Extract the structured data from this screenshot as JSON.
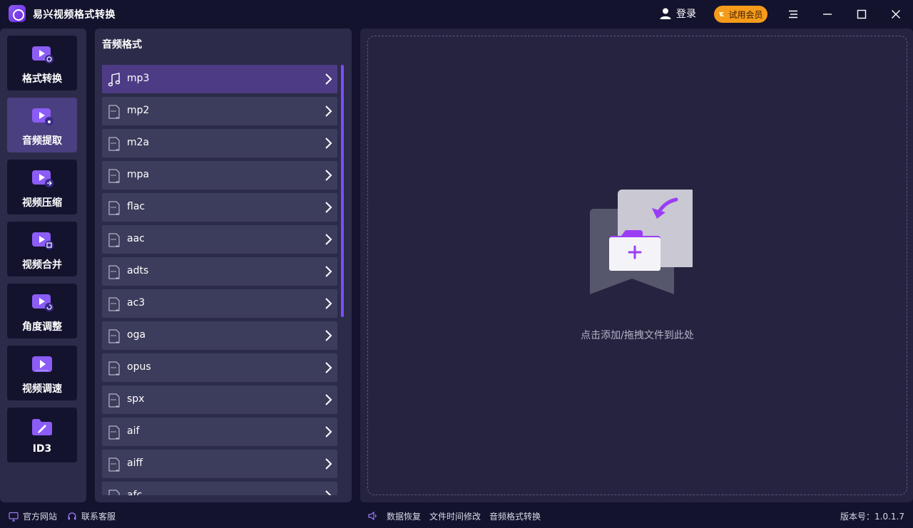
{
  "app": {
    "title": "易兴视频格式转换"
  },
  "header": {
    "login_label": "登录",
    "vip_label": "试用会员"
  },
  "nav": {
    "items": [
      {
        "label": "格式转换",
        "icon": "video-convert-icon",
        "active": false
      },
      {
        "label": "音频提取",
        "icon": "audio-extract-icon",
        "active": true
      },
      {
        "label": "视频压缩",
        "icon": "video-compress-icon",
        "active": false
      },
      {
        "label": "视频合并",
        "icon": "video-merge-icon",
        "active": false
      },
      {
        "label": "角度调整",
        "icon": "rotate-icon",
        "active": false
      },
      {
        "label": "视频调速",
        "icon": "speed-icon",
        "active": false
      },
      {
        "label": "ID3",
        "icon": "id3-edit-icon",
        "active": false
      }
    ]
  },
  "format_panel": {
    "title": "音频格式",
    "selected": "mp3",
    "formats": [
      "mp3",
      "mp2",
      "m2a",
      "mpa",
      "flac",
      "aac",
      "adts",
      "ac3",
      "oga",
      "opus",
      "spx",
      "aif",
      "aiff",
      "afc"
    ]
  },
  "drop_zone": {
    "hint": "点击添加/拖拽文件到此处"
  },
  "footer": {
    "official_site": "官方网站",
    "contact_support": "联系客服",
    "data_recovery": "数据恢复",
    "file_time_edit": "文件时间修改",
    "audio_format_convert": "音频格式转换",
    "version": "版本号：1.0.1.7"
  },
  "colors": {
    "background": "#13132e",
    "panel": "#2c2c4a",
    "accent": "#7c4dff",
    "vip": "#f59a1b",
    "selected_item": "#4d3c85"
  }
}
